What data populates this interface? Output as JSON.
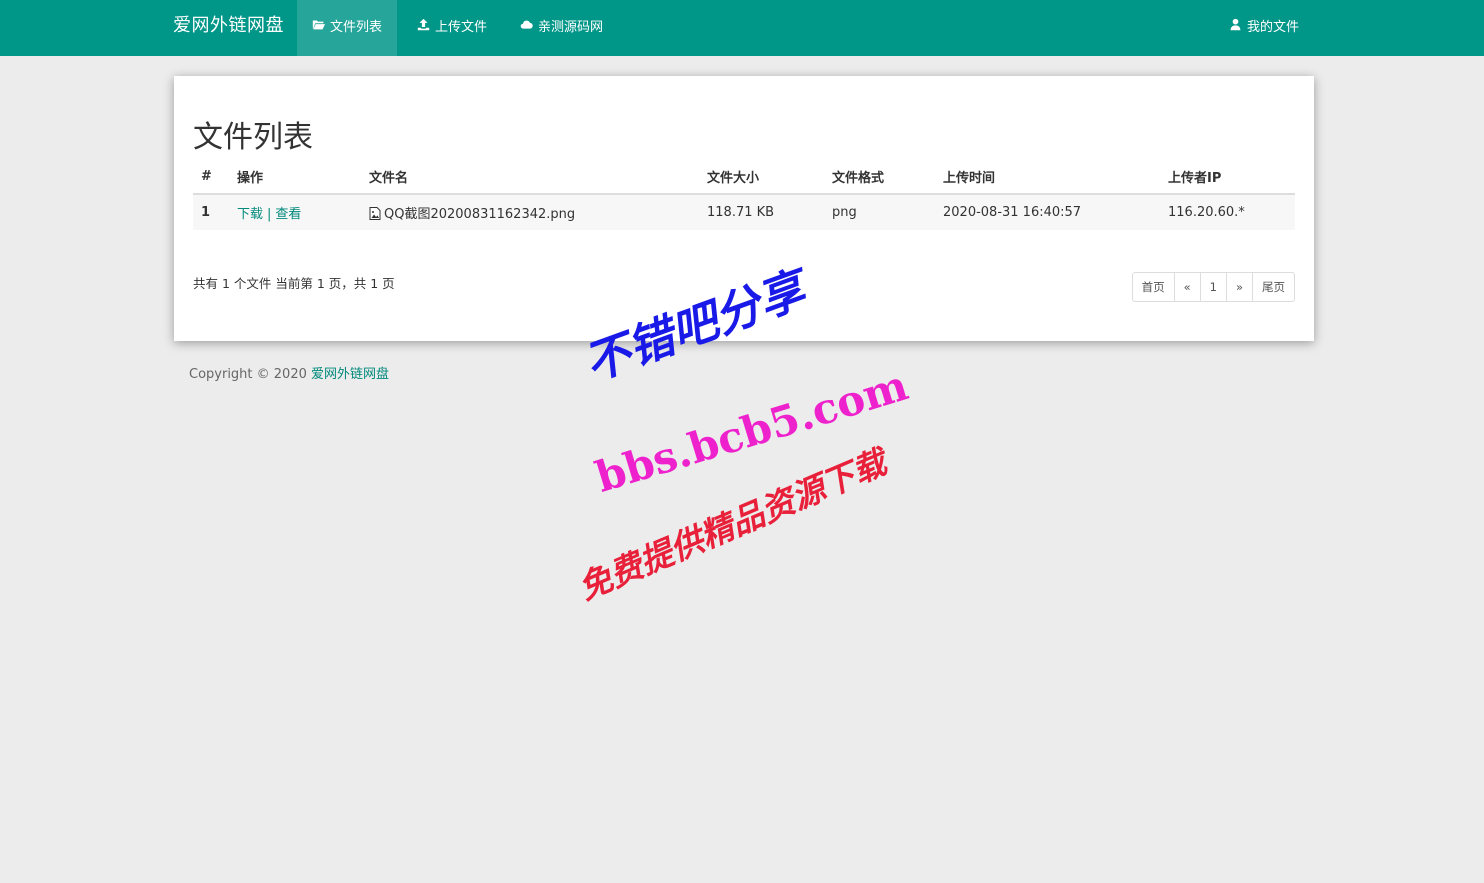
{
  "nav": {
    "brand": "爱网外链网盘",
    "items": [
      {
        "label": "文件列表",
        "icon": "folder-open-icon",
        "active": true
      },
      {
        "label": "上传文件",
        "icon": "upload-icon",
        "active": false
      },
      {
        "label": "亲测源码网",
        "icon": "cloud-icon",
        "active": false
      }
    ],
    "user_label": "我的文件",
    "user_icon": "user-icon"
  },
  "panel": {
    "title": "文件列表",
    "table": {
      "headers": [
        "#",
        "操作",
        "文件名",
        "文件大小",
        "文件格式",
        "上传时间",
        "上传者IP"
      ],
      "rows": [
        {
          "num": "1",
          "download": "下载",
          "separator": "|",
          "view": "查看",
          "filename": "QQ截图20200831162342.png",
          "size": "118.71 KB",
          "format": "png",
          "time": "2020-08-31 16:40:57",
          "ip": "116.20.60.*"
        }
      ]
    },
    "summary": "共有 1 个文件  当前第 1 页，共 1 页",
    "pagination": [
      "首页",
      "«",
      "1",
      "»",
      "尾页"
    ]
  },
  "footer": {
    "copyright": "Copyright © 2020 ",
    "site_link": "爱网外链网盘"
  },
  "watermark": {
    "line1": "不错吧分享",
    "line2": "bbs.bcb5.com",
    "line3": "免费提供精品资源下载"
  },
  "colors": {
    "navbar": "#009688",
    "nav_active": "#26a69a",
    "link": "#00897b",
    "background": "#ececec"
  }
}
